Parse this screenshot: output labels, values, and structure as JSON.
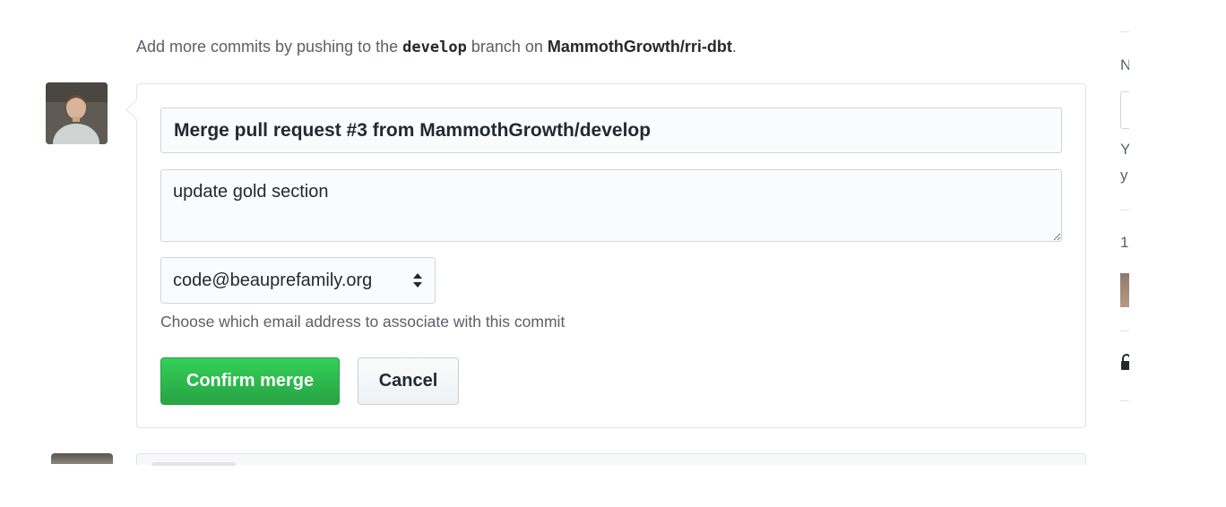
{
  "hint": {
    "prefix": "Add more commits by pushing to the",
    "branch": "develop",
    "middle": "branch on",
    "repo": "MammothGrowth/rri-dbt",
    "suffix": "."
  },
  "merge_form": {
    "commit_title": "Merge pull request #3 from MammothGrowth/develop",
    "commit_message": "update gold section",
    "email_selected": "code@beauprefamily.org",
    "email_note": "Choose which email address to associate with this commit",
    "confirm_label": "Confirm merge",
    "cancel_label": "Cancel"
  },
  "sidebar": {
    "heading_fragment": "N",
    "line1_fragment": "Y",
    "line2_fragment": "y",
    "count_fragment": "1"
  },
  "icons": {
    "select_caret": "up-down-caret-icon",
    "lock": "lock-icon"
  },
  "colors": {
    "confirm_button": "#2ea44f",
    "border": "#e1e4e8",
    "muted_text": "#586069"
  }
}
